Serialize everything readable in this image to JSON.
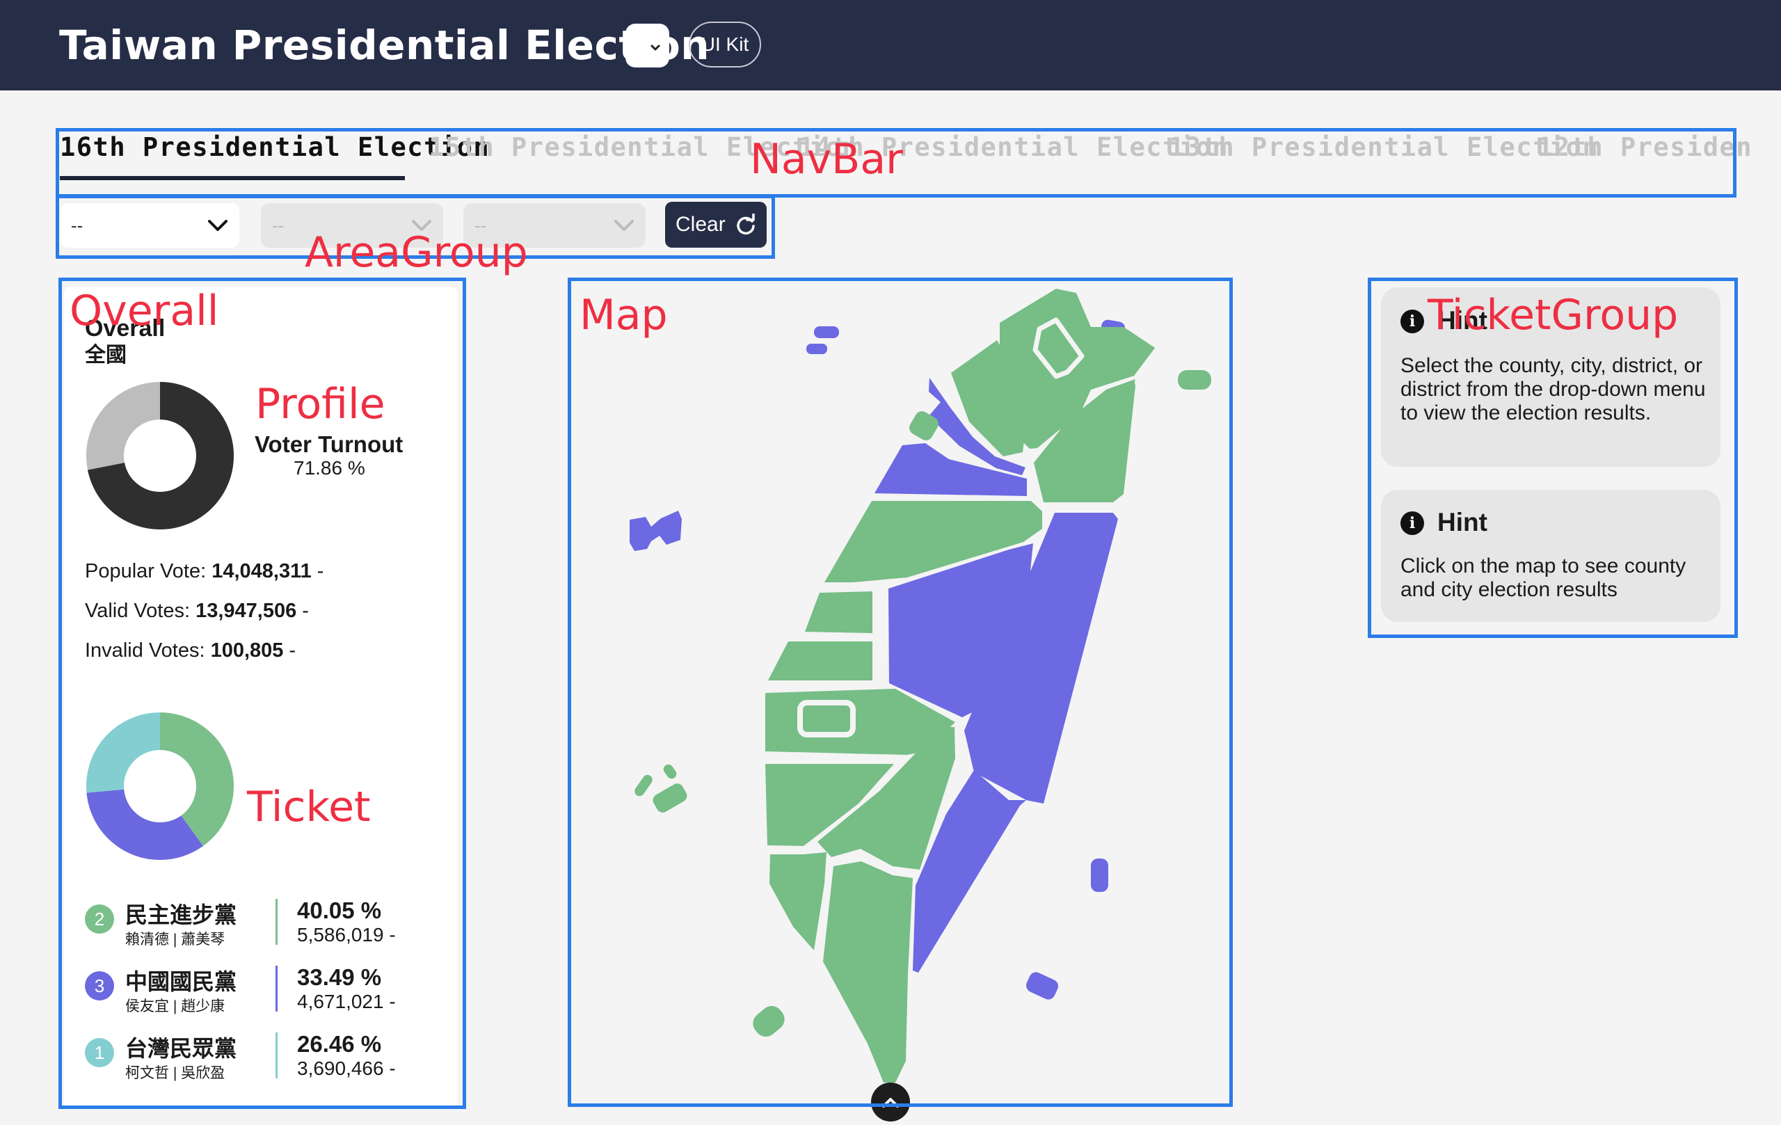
{
  "header": {
    "title": "Taiwan Presidential Election",
    "ui_kit_label": "UI Kit"
  },
  "annotations": {
    "navbar": "NavBar",
    "area_group": "AreaGroup",
    "overall": "Overall",
    "profile": "Profile",
    "ticket": "Ticket",
    "map": "Map",
    "ticket_group": "TicketGroup"
  },
  "tabs": [
    {
      "label": "16th Presidential Election",
      "active": true
    },
    {
      "label": "15th Presidential Election",
      "active": false
    },
    {
      "label": "14th Presidential Election",
      "active": false
    },
    {
      "label": "13th Presidential Election",
      "active": false
    },
    {
      "label": "12th Presiden",
      "active": false
    }
  ],
  "filters": {
    "county": "--",
    "town": "--",
    "village": "--",
    "clear_label": "Clear"
  },
  "overall": {
    "title": "Overall",
    "subtitle": "全國",
    "turnout_label": "Voter Turnout",
    "turnout_value": "71.86 %",
    "turnout_fraction": 0.7186,
    "popular_vote_label": "Popular Vote:",
    "popular_vote": "14,048,311",
    "valid_votes_label": "Valid Votes:",
    "valid_votes": "13,947,506",
    "invalid_votes_label": "Invalid Votes:",
    "invalid_votes": "100,805",
    "suffix": " -"
  },
  "candidates": [
    {
      "number": "2",
      "party": "民主進步黨",
      "names": "賴清德 | 蕭美琴",
      "percent": "40.05 %",
      "votes": "5,586,019 -",
      "share": 40.05,
      "color": "#7bbf8b"
    },
    {
      "number": "3",
      "party": "中國國民黨",
      "names": "侯友宜 | 趙少康",
      "percent": "33.49 %",
      "votes": "4,671,021 -",
      "share": 33.49,
      "color": "#6b68e0"
    },
    {
      "number": "1",
      "party": "台灣民眾黨",
      "names": "柯文哲 | 吳欣盈",
      "percent": "26.46 %",
      "votes": "3,690,466 -",
      "share": 26.46,
      "color": "#84ced2"
    }
  ],
  "hints": [
    {
      "title": "Hint",
      "text": "Select the county, city, district, or district from the drop-down menu to view the election results."
    },
    {
      "title": "Hint",
      "text": "Click on the map to see county and city election results"
    }
  ],
  "colors": {
    "dpp_green": "#76bd86",
    "kmt_purple": "#6c69e3",
    "tpp_teal": "#84ced2",
    "navy": "#262d47",
    "annotation_blue": "#2b7de9",
    "annotation_red": "#ee2e42"
  }
}
